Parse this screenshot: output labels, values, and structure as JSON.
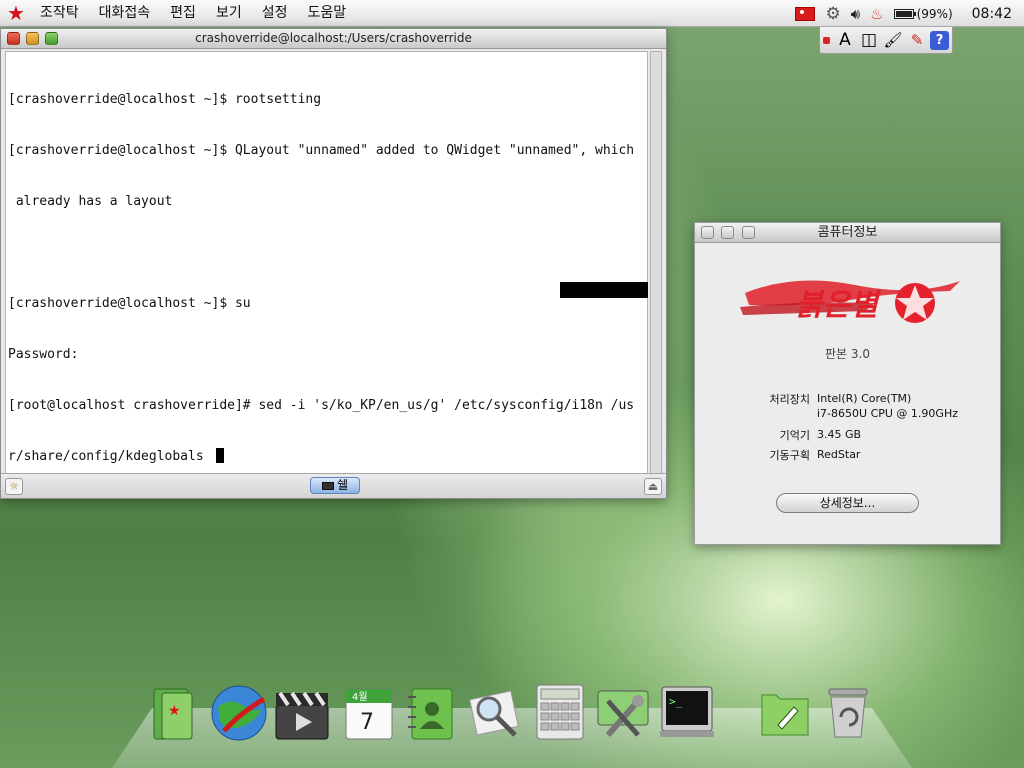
{
  "menubar": {
    "app_menu": [
      "조작탁",
      "대화접속",
      "편집",
      "보기",
      "설정",
      "도움말"
    ],
    "battery_text": "(99%)",
    "battery_level": 0.99,
    "clock": "08:42",
    "tray_icons": [
      "flag-icon",
      "settings-gear-icon",
      "volume-icon",
      "flame-icon",
      "battery-icon"
    ]
  },
  "ime_toolbar": {
    "mode_label": "A",
    "buttons": [
      "input-mode-icon",
      "layout-icon",
      "brush-icon",
      "tool-icon",
      "help-icon"
    ],
    "help_label": "?"
  },
  "terminal": {
    "title": "crashoverride@localhost:/Users/crashoverride",
    "lines": [
      "[crashoverride@localhost ~]$ rootsetting",
      "[crashoverride@localhost ~]$ QLayout \"unnamed\" added to QWidget \"unnamed\", which",
      " already has a layout",
      "",
      "[crashoverride@localhost ~]$ su",
      "Password:",
      "[root@localhost crashoverride]# sed -i 's/ko_KP/en_us/g' /etc/sysconfig/i18n /us",
      "r/share/config/kdeglobals "
    ],
    "tab_label": "쉘"
  },
  "about": {
    "title": "콤퓨터정보",
    "logo_text": "붉은별",
    "version": "판본 3.0",
    "processor_label": "처리장치",
    "processor_value_1": "Intel(R) Core(TM)",
    "processor_value_2": "i7-8650U CPU @ 1.90GHz",
    "memory_label": "기억기",
    "memory_value": "3.45 GB",
    "storage_label": "기동구획",
    "storage_value": "RedStar",
    "details_button": "상세정보..."
  },
  "dock": {
    "items": [
      "file-manager-icon",
      "web-browser-icon",
      "media-player-icon",
      "calendar-icon",
      "address-book-icon",
      "image-viewer-icon",
      "calculator-icon",
      "system-settings-icon",
      "terminal-icon",
      "text-editor-icon",
      "trash-icon"
    ],
    "calendar_month": "4월",
    "calendar_day": "7"
  },
  "colors": {
    "accent_red": "#d6121b",
    "desktop_green": "#5f8e55"
  }
}
